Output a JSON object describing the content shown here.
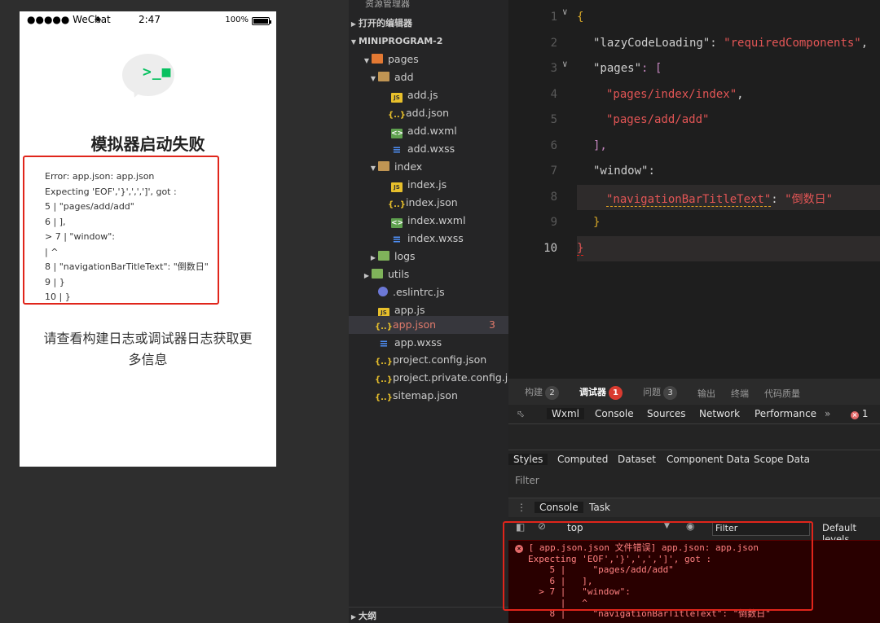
{
  "simulator": {
    "status": {
      "carrier": "●●●●● WeChat",
      "wifi_icon": "wifi-icon",
      "time": "2:47",
      "battery": "100%"
    },
    "title": "模拟器启动失败",
    "error_lines": [
      "Error: app.json: app.json",
      "Expecting 'EOF','}',',',']', got :",
      "5 | \"pages/add/add\"",
      "6 | ],",
      "> 7 | \"window\":",
      "| ^",
      "8 | \"navigationBarTitleText\": \"倒数日\"",
      "9 | }",
      "10 | }"
    ],
    "hint": "请查看构建日志或调试器日志获取更多信息"
  },
  "explorer": {
    "top_label": "资源管理器",
    "open_editors": "打开的编辑器",
    "project": "MINIPROGRAM-2",
    "items": [
      {
        "label": "pages",
        "type": "folder-pages"
      },
      {
        "label": "add",
        "type": "folder"
      },
      {
        "label": "add.js",
        "type": "js"
      },
      {
        "label": "add.json",
        "type": "json"
      },
      {
        "label": "add.wxml",
        "type": "wxml"
      },
      {
        "label": "add.wxss",
        "type": "wxss"
      },
      {
        "label": "index",
        "type": "folder"
      },
      {
        "label": "index.js",
        "type": "js"
      },
      {
        "label": "index.json",
        "type": "json"
      },
      {
        "label": "index.wxml",
        "type": "wxml"
      },
      {
        "label": "index.wxss",
        "type": "wxss"
      },
      {
        "label": "logs",
        "type": "folder-green"
      },
      {
        "label": "utils",
        "type": "folder-green"
      },
      {
        "label": ".eslintrc.js",
        "type": "dot"
      },
      {
        "label": "app.js",
        "type": "js"
      },
      {
        "label": "app.json",
        "type": "json",
        "badge": "3"
      },
      {
        "label": "app.wxss",
        "type": "wxss"
      },
      {
        "label": "project.config.json",
        "type": "json"
      },
      {
        "label": "project.private.config.js...",
        "type": "json"
      },
      {
        "label": "sitemap.json",
        "type": "json"
      }
    ],
    "outline": "大纲"
  },
  "editor": {
    "line_numbers": [
      "1",
      "2",
      "3",
      "4",
      "5",
      "6",
      "7",
      "8",
      "9",
      "10"
    ],
    "lines": [
      "{",
      "\"lazyCodeLoading\"",
      ": ",
      "\"requiredComponents\"",
      ",",
      "\"pages\"",
      ": [",
      "\"pages/index/index\"",
      "\"pages/add/add\"",
      "],",
      "\"window\"",
      ":",
      "\"navigationBarTitleText\"",
      "\"倒数日\"",
      "}",
      "}"
    ]
  },
  "devtools": {
    "top_tabs": [
      {
        "label": "构建",
        "count": "2"
      },
      {
        "label": "调试器",
        "count": "1"
      },
      {
        "label": "问题",
        "count": "3"
      },
      {
        "label": "输出"
      },
      {
        "label": "终端"
      },
      {
        "label": "代码质量"
      }
    ],
    "panel_tabs": [
      "Wxml",
      "Console",
      "Sources",
      "Network",
      "Performance",
      "»"
    ],
    "error_count": "1",
    "style_tabs": [
      "Styles",
      "Computed",
      "Dataset",
      "Component Data",
      "Scope Data"
    ],
    "filter_placeholder": "Filter",
    "drawer_tabs": [
      "Console",
      "Task"
    ],
    "context": "top",
    "console_filter": "Filter",
    "levels": "Default levels",
    "console_lines": [
      "[ app.json.json 文件错误] app.json: app.json",
      "Expecting 'EOF','}',',',']', got :",
      "    5 |     \"pages/add/add\"",
      "    6 |   ],",
      "  > 7 |   \"window\":",
      "      |   ^",
      "    8 |     \"navigationBarTitleText\": \"倒数日\""
    ]
  }
}
